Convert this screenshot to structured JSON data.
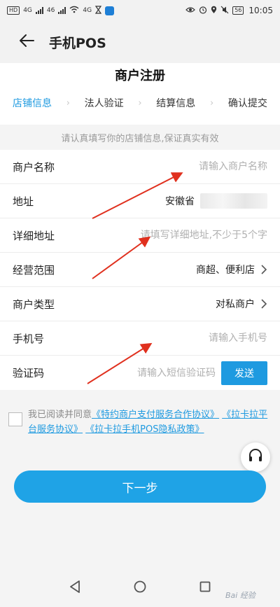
{
  "status_bar": {
    "left": [
      "HD",
      "4G",
      "46",
      "4G"
    ],
    "battery": "56",
    "time": "10:05"
  },
  "app_bar": {
    "title": "手机POS"
  },
  "page": {
    "title": "商户注册"
  },
  "steps": [
    {
      "label": "店铺信息",
      "active": true
    },
    {
      "label": "法人验证",
      "active": false
    },
    {
      "label": "结算信息",
      "active": false
    },
    {
      "label": "确认提交",
      "active": false
    }
  ],
  "notice": "请认真填写你的店铺信息,保证真实有效",
  "form": {
    "merchant_name": {
      "label": "商户名称",
      "placeholder": "请输入商户名称",
      "value": ""
    },
    "address": {
      "label": "地址",
      "value": "安徽省"
    },
    "detail_address": {
      "label": "详细地址",
      "placeholder": "请填写详细地址,不少于5个字",
      "value": ""
    },
    "business_scope": {
      "label": "经营范围",
      "value": "商超、便利店"
    },
    "merchant_type": {
      "label": "商户类型",
      "value": "对私商户"
    },
    "phone": {
      "label": "手机号",
      "placeholder": "请输入手机号",
      "value": ""
    },
    "code": {
      "label": "验证码",
      "placeholder": "请输入短信验证码",
      "value": "",
      "send_label": "发送"
    }
  },
  "agreement": {
    "prefix": "我已阅读并同意",
    "link1": "《特约商户支付服务合作协议》",
    "link2": "《拉卡拉平台服务协议》",
    "link3": "《拉卡拉手机POS隐私政策》",
    "checked": false
  },
  "next_button": "下一步",
  "watermark": "Bai 经验",
  "colors": {
    "accent": "#1e9ae0",
    "annotation": "#e0301e"
  },
  "icons": {
    "back": "back-arrow-icon",
    "support": "headset-icon",
    "chevron": "chevron-right-icon"
  }
}
